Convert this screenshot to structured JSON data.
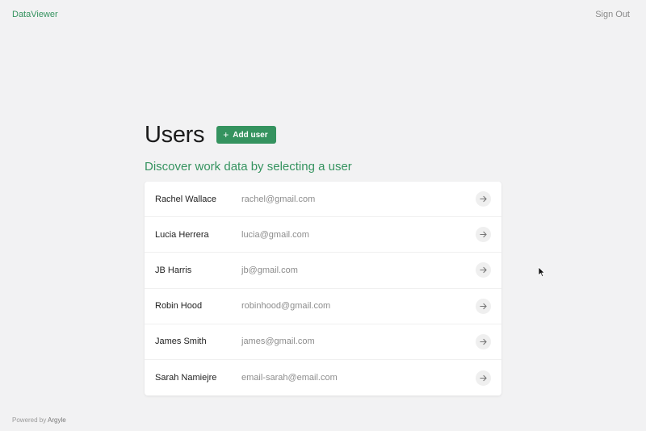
{
  "header": {
    "brand": "DataViewer",
    "sign_out": "Sign Out"
  },
  "main": {
    "title": "Users",
    "add_user_label": "Add user",
    "subtitle": "Discover work data by selecting a user",
    "users": [
      {
        "name": "Rachel Wallace",
        "email": "rachel@gmail.com"
      },
      {
        "name": "Lucia Herrera",
        "email": "lucia@gmail.com"
      },
      {
        "name": "JB Harris",
        "email": "jb@gmail.com"
      },
      {
        "name": "Robin Hood",
        "email": "robinhood@gmail.com"
      },
      {
        "name": "James Smith",
        "email": "james@gmail.com"
      },
      {
        "name": "Sarah Namiejre",
        "email": "email-sarah@email.com"
      }
    ]
  },
  "footer": {
    "powered_by": "Powered by",
    "company": "Argyle"
  },
  "icons": {
    "add": "plus-icon",
    "row_action": "arrow-right-icon"
  },
  "colors": {
    "accent": "#35935f",
    "background": "#f2f2f3"
  }
}
